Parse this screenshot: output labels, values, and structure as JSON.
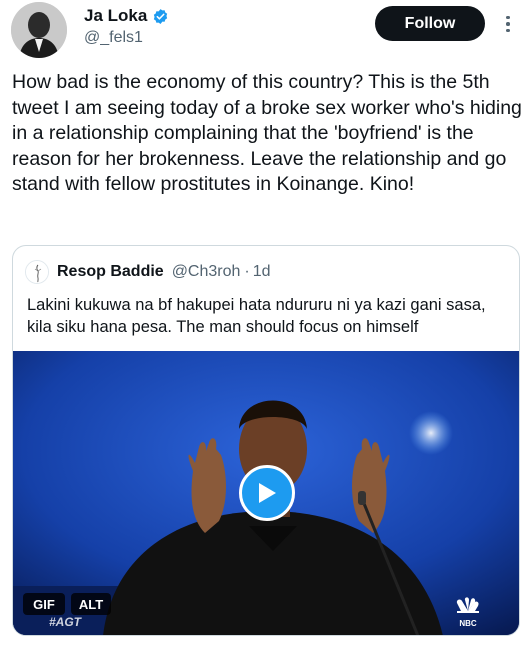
{
  "author": {
    "display_name": "Ja Loka",
    "handle": "@_fels1",
    "verified": true,
    "follow_label": "Follow"
  },
  "tweet": {
    "text": "How bad is the economy of this country? This is the 5th tweet I am seeing today of a broke sex worker who's hiding in a relationship complaining that the 'boyfriend' is the reason for her brokenness. Leave the relationship and go stand with fellow prostitutes in Koinange. Kino!"
  },
  "quoted_tweet": {
    "display_name": "Resop Baddie",
    "handle": "@Ch3roh",
    "separator": "·",
    "time": "1d",
    "text": "Lakini kukuwa na bf hakupei hata ndururu ni ya kazi gani sasa, kila siku hana pesa. The man should focus on himself",
    "media": {
      "type": "gif",
      "gif_label": "GIF",
      "alt_label": "ALT",
      "overlay_tag": "#AGT",
      "network_logo": "NBC"
    }
  },
  "colors": {
    "text_primary": "#0f1419",
    "text_secondary": "#536471",
    "verified_blue": "#1d9bf0",
    "follow_button_bg": "#0f1419",
    "border": "#cfd9de"
  }
}
